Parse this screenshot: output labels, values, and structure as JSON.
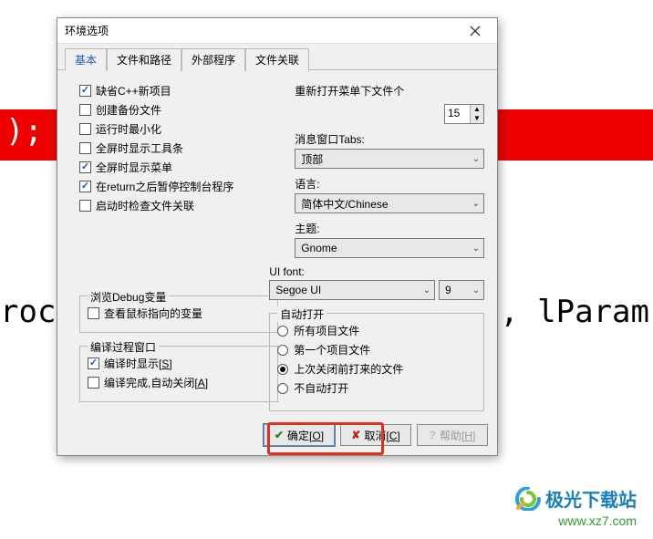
{
  "bg": {
    "red_text": ");",
    "code_left": "roc ",
    "code_right": ", lParam"
  },
  "logo": {
    "title": "极光下载站",
    "url": "www.xz7.com"
  },
  "dialog": {
    "title": "环境选项",
    "tabs": {
      "basic": "基本",
      "paths": "文件和路径",
      "external": "外部程序",
      "assoc": "文件关联"
    },
    "checks": {
      "default_cpp": "缺省C++新项目",
      "backup": "创建备份文件",
      "minimize": "运行时最小化",
      "fullscreen_toolbar": "全屏时显示工具条",
      "fullscreen_menu": "全屏时显示菜单",
      "pause_return": "在return之后暂停控制台程序",
      "check_assoc": "启动时检查文件关联"
    },
    "debug_group": {
      "title": "浏览Debug变量",
      "mouse_var": "查看鼠标指向的变量"
    },
    "compile_group": {
      "title": "编译过程窗口",
      "show_s": "编译时显示",
      "show_s_key": "S",
      "auto_close_a": "编译完成,自动关闭",
      "auto_close_a_key": "A"
    },
    "right": {
      "reopen_label": "重新打开菜单下文件个",
      "reopen_value": "15",
      "tabs_label": "消息窗口Tabs:",
      "tabs_value": "顶部",
      "lang_label": "语言:",
      "lang_value": "简体中文/Chinese",
      "theme_label": "主题:",
      "theme_value": "Gnome",
      "uifont_label": "UI font:",
      "uifont_value": "Segoe UI",
      "uifont_size": "9"
    },
    "autoopen": {
      "title": "自动打开",
      "r1": "所有项目文件",
      "r2": "第一个项目文件",
      "r3": "上次关闭前打来的文件",
      "r4": "不自动打开"
    },
    "buttons": {
      "ok": "确定",
      "ok_key": "O",
      "cancel": "取消",
      "cancel_key": "C",
      "help": "帮助",
      "help_key": "H"
    }
  }
}
